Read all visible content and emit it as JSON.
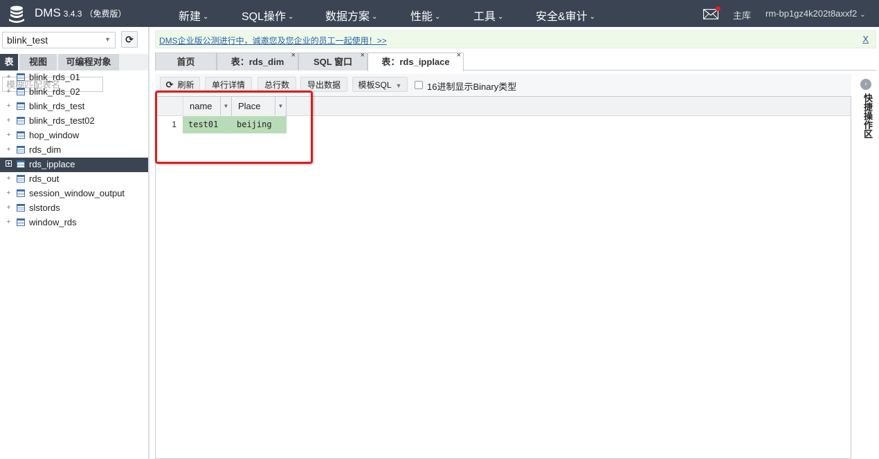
{
  "header": {
    "brand": "DMS",
    "version": "3.4.3",
    "edition": "（免费版）",
    "nav": [
      {
        "label": "新建"
      },
      {
        "label": "SQL操作"
      },
      {
        "label": "数据方案"
      },
      {
        "label": "性能"
      },
      {
        "label": "工具"
      },
      {
        "label": "安全&审计"
      }
    ],
    "master_label": "主库",
    "instance": "rm-bp1gz4k202t8axxf2"
  },
  "sidebar": {
    "database": "blink_test",
    "tabs": [
      {
        "label": "表"
      },
      {
        "label": "视图"
      },
      {
        "label": "可编程对象"
      }
    ],
    "filter_placeholder": "模糊匹配表名",
    "tables": [
      {
        "label": "blink_rds_01"
      },
      {
        "label": "blink_rds_02"
      },
      {
        "label": "blink_rds_test"
      },
      {
        "label": "blink_rds_test02"
      },
      {
        "label": "hop_window"
      },
      {
        "label": "rds_dim"
      },
      {
        "label": "rds_ipplace"
      },
      {
        "label": "rds_out"
      },
      {
        "label": "session_window_output"
      },
      {
        "label": "slstords"
      },
      {
        "label": "window_rds"
      }
    ],
    "selected_table": "rds_ipplace"
  },
  "notice": {
    "text": "DMS企业版公测进行中，诚邀您及您企业的员工一起使用！>>",
    "close": "X"
  },
  "tabs": [
    {
      "label": "首页"
    },
    {
      "label": "表：rds_dim",
      "close": "×"
    },
    {
      "label": "SQL 窗口",
      "close": "×"
    },
    {
      "label": "表：rds_ipplace",
      "close": "×"
    }
  ],
  "toolbar": {
    "refresh": "刷新",
    "row_detail": "单行详情",
    "total_rows": "总行数",
    "export": "导出数据",
    "template_sql": "模板SQL",
    "hex_binary": "16进制显示Binary类型"
  },
  "grid": {
    "columns": [
      {
        "label": "name"
      },
      {
        "label": "Place"
      }
    ],
    "rows": [
      {
        "num": "1",
        "cells": [
          "test01",
          "beijing"
        ]
      }
    ]
  },
  "right_panel": {
    "label": "快捷操作区",
    "collapse_icon": "‹"
  }
}
